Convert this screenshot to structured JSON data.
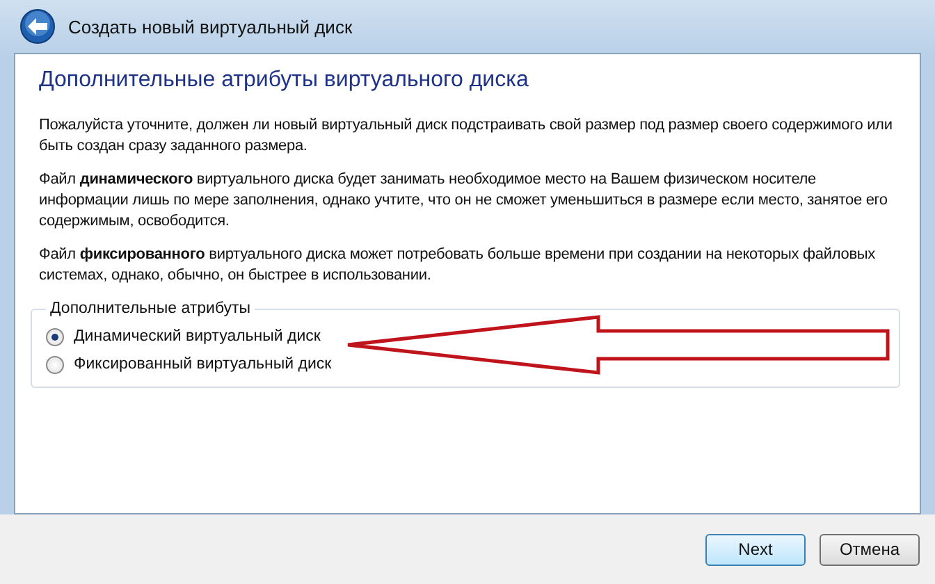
{
  "window": {
    "title": "Создать новый виртуальный диск"
  },
  "heading": "Дополнительные атрибуты виртуального диска",
  "paragraphs": [
    "Пожалуйста уточните, должен ли новый виртуальный диск подстраивать свой размер под размер своего содержимого или быть создан сразу заданного размера.",
    "Файл **динамического** виртуального диска будет занимать необходимое место на Вашем физическом носителе информации лишь по мере заполнения, однако учтите, что он не сможет уменьшиться в размере если место, занятое его содержимым, освободится.",
    "Файл **фиксированного** виртуального диска может потребовать больше времени при создании на некоторых файловых системах, однако, обычно, он быстрее в использовании."
  ],
  "group": {
    "legend": "Дополнительные атрибуты",
    "options": [
      {
        "label": "Динамический виртуальный диск",
        "selected": true
      },
      {
        "label": "Фиксированный виртуальный диск",
        "selected": false
      }
    ]
  },
  "buttons": [
    {
      "label": "Next",
      "default": true
    },
    {
      "label": "Отмена",
      "default": false
    }
  ]
}
